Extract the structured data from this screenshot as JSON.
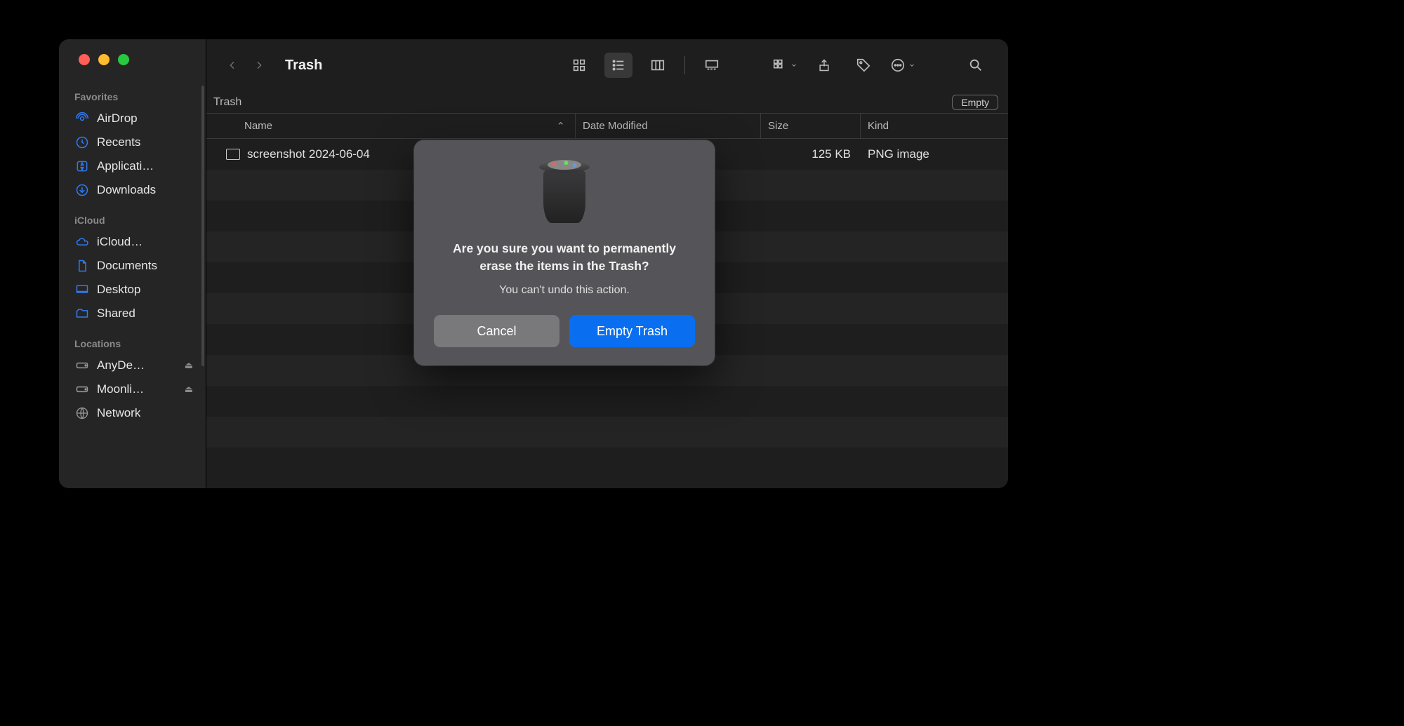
{
  "window": {
    "title": "Trash",
    "subheader": {
      "location": "Trash",
      "empty_button": "Empty"
    }
  },
  "sidebar": {
    "sections": {
      "favorites": {
        "label": "Favorites",
        "items": [
          {
            "label": "AirDrop"
          },
          {
            "label": "Recents"
          },
          {
            "label": "Applicati…"
          },
          {
            "label": "Downloads"
          }
        ]
      },
      "icloud": {
        "label": "iCloud",
        "items": [
          {
            "label": "iCloud…"
          },
          {
            "label": "Documents"
          },
          {
            "label": "Desktop"
          },
          {
            "label": "Shared"
          }
        ]
      },
      "locations": {
        "label": "Locations",
        "items": [
          {
            "label": "AnyDe…",
            "ejectable": true
          },
          {
            "label": "Moonli…",
            "ejectable": true
          },
          {
            "label": "Network"
          }
        ]
      }
    }
  },
  "columns": {
    "name": "Name",
    "date_modified": "Date Modified",
    "size": "Size",
    "kind": "Kind"
  },
  "files": [
    {
      "name": "screenshot 2024-06-04",
      "date_modified": "",
      "size": "125 KB",
      "kind": "PNG image"
    }
  ],
  "dialog": {
    "title": "Are you sure you want to permanently erase the items in the Trash?",
    "subtitle": "You can't undo this action.",
    "cancel": "Cancel",
    "confirm": "Empty Trash"
  }
}
